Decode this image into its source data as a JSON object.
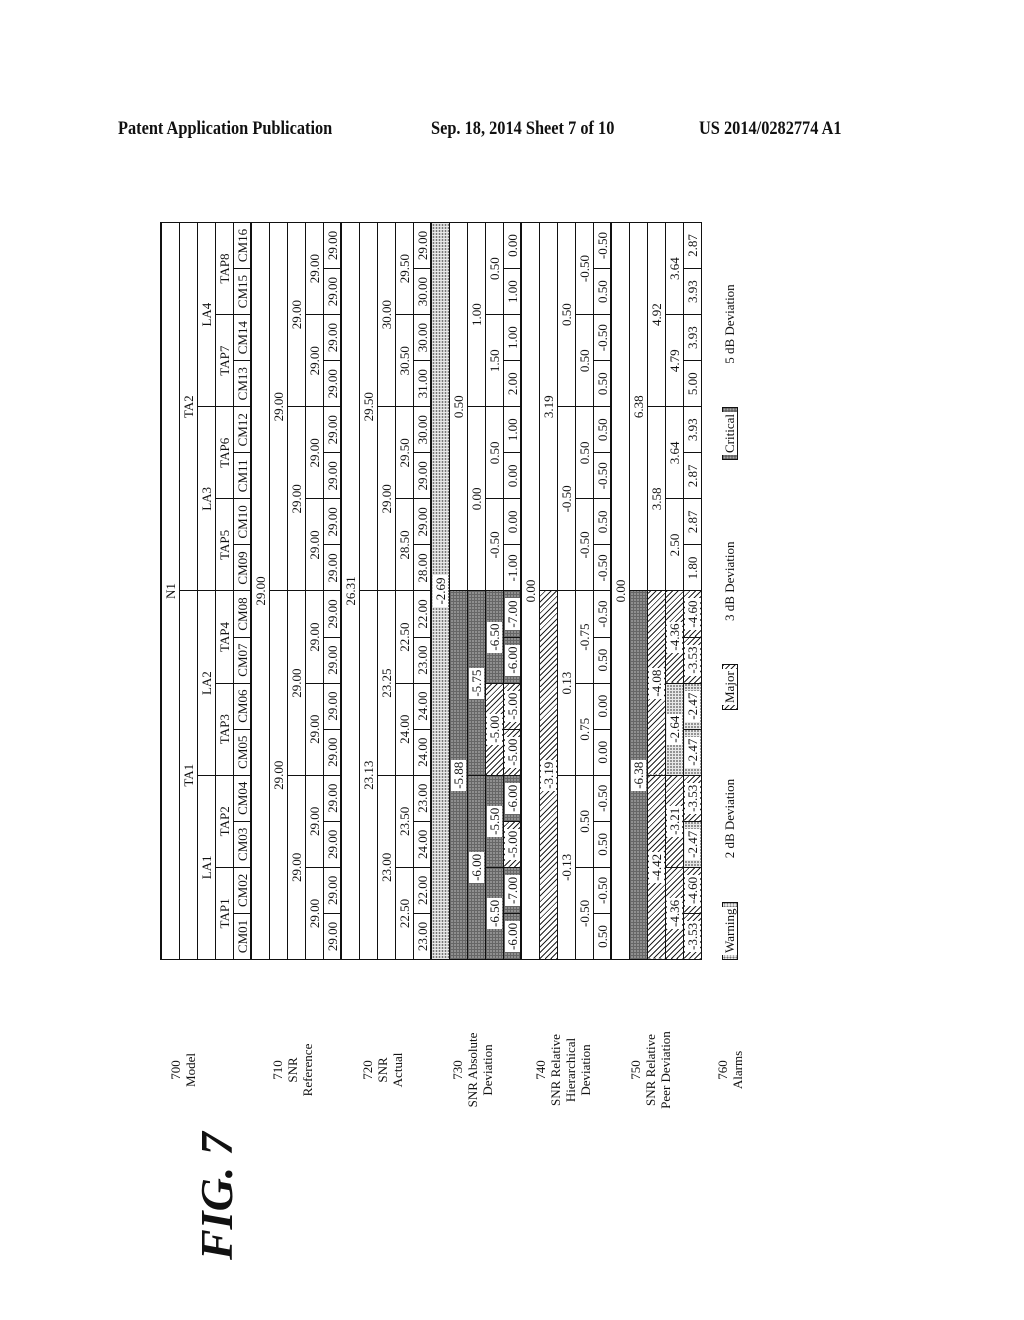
{
  "header": {
    "left": "Patent Application Publication",
    "date_sheet": "Sep. 18, 2014   Sheet 7 of 10",
    "number": "US 2014/0282774 A1"
  },
  "figure_label": "FIG. 7",
  "row_labels": {
    "model": [
      "700",
      "Model"
    ],
    "reference": [
      "710",
      "SNR",
      "Reference"
    ],
    "actual": [
      "720",
      "SNR",
      "Actual"
    ],
    "absolute": [
      "730",
      "SNR Absolute",
      "Deviation"
    ],
    "hierarchical": [
      "740",
      "SNR Relative",
      "Hierarchical",
      "Deviation"
    ],
    "peer": [
      "750",
      "SNR Relative",
      "Peer Deviation"
    ],
    "alarms": [
      "760",
      "Alarms"
    ]
  },
  "model": {
    "n": [
      "N1"
    ],
    "ta": [
      "TA1",
      "TA2"
    ],
    "la": [
      "LA1",
      "LA2",
      "LA3",
      "LA4"
    ],
    "tap": [
      "TAP1",
      "TAP2",
      "TAP3",
      "TAP4",
      "TAP5",
      "TAP6",
      "TAP7",
      "TAP8"
    ],
    "cm": [
      "CM01",
      "CM02",
      "CM03",
      "CM04",
      "CM05",
      "CM06",
      "CM07",
      "CM08",
      "CM09",
      "CM10",
      "CM11",
      "CM12",
      "CM13",
      "CM14",
      "CM15",
      "CM16"
    ]
  },
  "reference": {
    "n": [
      "29.00"
    ],
    "ta": [
      "29.00",
      "29.00"
    ],
    "la": [
      "29.00",
      "29.00",
      "29.00",
      "29.00"
    ],
    "tap": [
      "29.00",
      "29.00",
      "29.00",
      "29.00",
      "29.00",
      "29.00",
      "29.00",
      "29.00"
    ],
    "cm": [
      "29.00",
      "29.00",
      "29.00",
      "29.00",
      "29.00",
      "29.00",
      "29.00",
      "29.00",
      "29.00",
      "29.00",
      "29.00",
      "29.00",
      "29.00",
      "29.00",
      "29.00",
      "29.00"
    ]
  },
  "actual": {
    "n": [
      "26.31"
    ],
    "ta": [
      "23.13",
      "29.50"
    ],
    "la": [
      "23.00",
      "23.25",
      "29.00",
      "30.00"
    ],
    "tap": [
      "22.50",
      "23.50",
      "24.00",
      "22.50",
      "28.50",
      "29.50",
      "30.50",
      "29.50"
    ],
    "cm": [
      "23.00",
      "22.00",
      "24.00",
      "23.00",
      "24.00",
      "24.00",
      "23.00",
      "22.00",
      "28.00",
      "29.00",
      "29.00",
      "30.00",
      "31.00",
      "30.00",
      "30.00",
      "29.00"
    ]
  },
  "absolute": {
    "n": [
      "-2.69"
    ],
    "ta": [
      "-5.88",
      "0.50"
    ],
    "la": [
      "-6.00",
      "-5.75",
      "0.00",
      "1.00"
    ],
    "tap": [
      "-6.50",
      "-5.50",
      "-5.00",
      "-6.50",
      "-0.50",
      "0.50",
      "1.50",
      "0.50"
    ],
    "cm": [
      "-6.00",
      "-7.00",
      "-5.00",
      "-6.00",
      "-5.00",
      "-5.00",
      "-6.00",
      "-7.00",
      "-1.00",
      "0.00",
      "0.00",
      "1.00",
      "2.00",
      "1.00",
      "1.00",
      "0.00"
    ]
  },
  "absolute_alarms": {
    "n": [
      "warning"
    ],
    "ta": [
      "critical",
      ""
    ],
    "la": [
      "critical",
      "critical",
      "",
      ""
    ],
    "tap": [
      "critical",
      "critical",
      "major",
      "critical",
      "",
      "",
      "",
      ""
    ],
    "cm": [
      "critical",
      "critical",
      "major",
      "critical",
      "major",
      "major",
      "critical",
      "critical",
      "",
      "",
      "",
      "",
      "",
      "",
      "",
      ""
    ]
  },
  "hierarchical": {
    "n": [
      "0.00"
    ],
    "ta": [
      "-3.19",
      "3.19"
    ],
    "la": [
      "-0.13",
      "0.13",
      "-0.50",
      "0.50"
    ],
    "tap": [
      "-0.50",
      "0.50",
      "0.75",
      "-0.75",
      "-0.50",
      "0.50",
      "0.50",
      "-0.50"
    ],
    "cm": [
      "0.50",
      "-0.50",
      "0.50",
      "-0.50",
      "0.00",
      "0.00",
      "0.50",
      "-0.50",
      "-0.50",
      "0.50",
      "-0.50",
      "0.50",
      "0.50",
      "-0.50",
      "0.50",
      "-0.50"
    ]
  },
  "hierarchical_alarms": {
    "n": [
      ""
    ],
    "ta": [
      "major",
      ""
    ],
    "la": [
      "",
      "",
      "",
      ""
    ],
    "tap": [
      "",
      "",
      "",
      "",
      "",
      "",
      "",
      ""
    ],
    "cm": [
      "",
      "",
      "",
      "",
      "",
      "",
      "",
      "",
      "",
      "",
      "",
      "",
      "",
      "",
      "",
      ""
    ]
  },
  "peer": {
    "n": [
      "0.00"
    ],
    "ta": [
      "-6.38",
      "6.38"
    ],
    "la": [
      "-4.42",
      "-4.08",
      "3.58",
      "4.92"
    ],
    "tap": [
      "-4.36",
      "-3.21",
      "-2.64",
      "-4.36",
      "2.50",
      "3.64",
      "4.79",
      "3.64"
    ],
    "cm": [
      "-3.53",
      "-4.60",
      "-2.47",
      "-3.53",
      "-2.47",
      "-2.47",
      "-3.53",
      "-4.60",
      "1.80",
      "2.87",
      "2.87",
      "3.93",
      "5.00",
      "3.93",
      "3.93",
      "2.87"
    ]
  },
  "peer_alarms": {
    "n": [
      ""
    ],
    "ta": [
      "critical",
      ""
    ],
    "la": [
      "major",
      "major",
      "",
      ""
    ],
    "tap": [
      "major",
      "major",
      "warning",
      "major",
      "",
      "",
      "",
      ""
    ],
    "cm": [
      "major",
      "major",
      "warning",
      "major",
      "warning",
      "warning",
      "major",
      "major",
      "",
      "",
      "",
      "",
      "",
      "",
      "",
      ""
    ]
  },
  "legend": [
    {
      "swatch": "Warning",
      "style": "warning",
      "desc": "2 dB Deviation"
    },
    {
      "swatch": "Major",
      "style": "major",
      "desc": "3 dB Deviation"
    },
    {
      "swatch": "Critical",
      "style": "critical",
      "desc": "5 dB Deviation"
    }
  ]
}
